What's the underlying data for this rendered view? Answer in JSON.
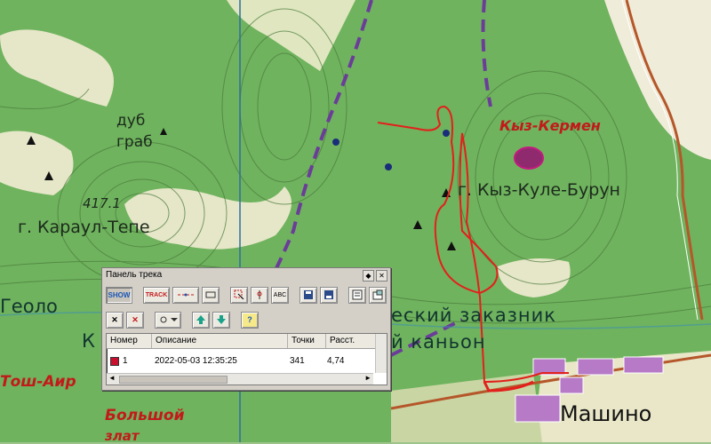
{
  "map": {
    "labels": {
      "oak": "дуб",
      "hornbeam": "граб",
      "elevation": "417.1",
      "karaul": "г. Караул-Тепе",
      "kyz_kermen": "Кыз-Кермен",
      "kyz_kule": "г. Кыз-Куле-Бурун",
      "geolo": "Геоло",
      "k": "К",
      "zakaznik": "еский заказник",
      "kanyon": "й каньон",
      "tosh_air": "Тош-Аир",
      "bolshoy": "Большой",
      "bolshoy2": "злат",
      "mashino": "Машино"
    },
    "colors": {
      "forest": "#6fb35e",
      "open": "#e9e7c8",
      "track": "#e3201b",
      "road": "#b5572a"
    }
  },
  "panel": {
    "title": "Панель трека",
    "title_buttons": [
      "pin-icon",
      "close-icon"
    ],
    "row1": [
      "show",
      "track",
      "points",
      "points2",
      "select",
      "marker",
      "abc",
      "save",
      "save-all",
      "list",
      "properties"
    ],
    "row2": [
      "delete",
      "delete-red",
      "route",
      "up",
      "down",
      "help"
    ],
    "columns": {
      "number": "Номер",
      "description": "Описание",
      "points": "Точки",
      "distance": "Расст."
    },
    "rows": [
      {
        "number": "1",
        "description": "2022-05-03 12:35:25",
        "points": "341",
        "distance": "4,74",
        "color": "#c8102e"
      }
    ]
  }
}
